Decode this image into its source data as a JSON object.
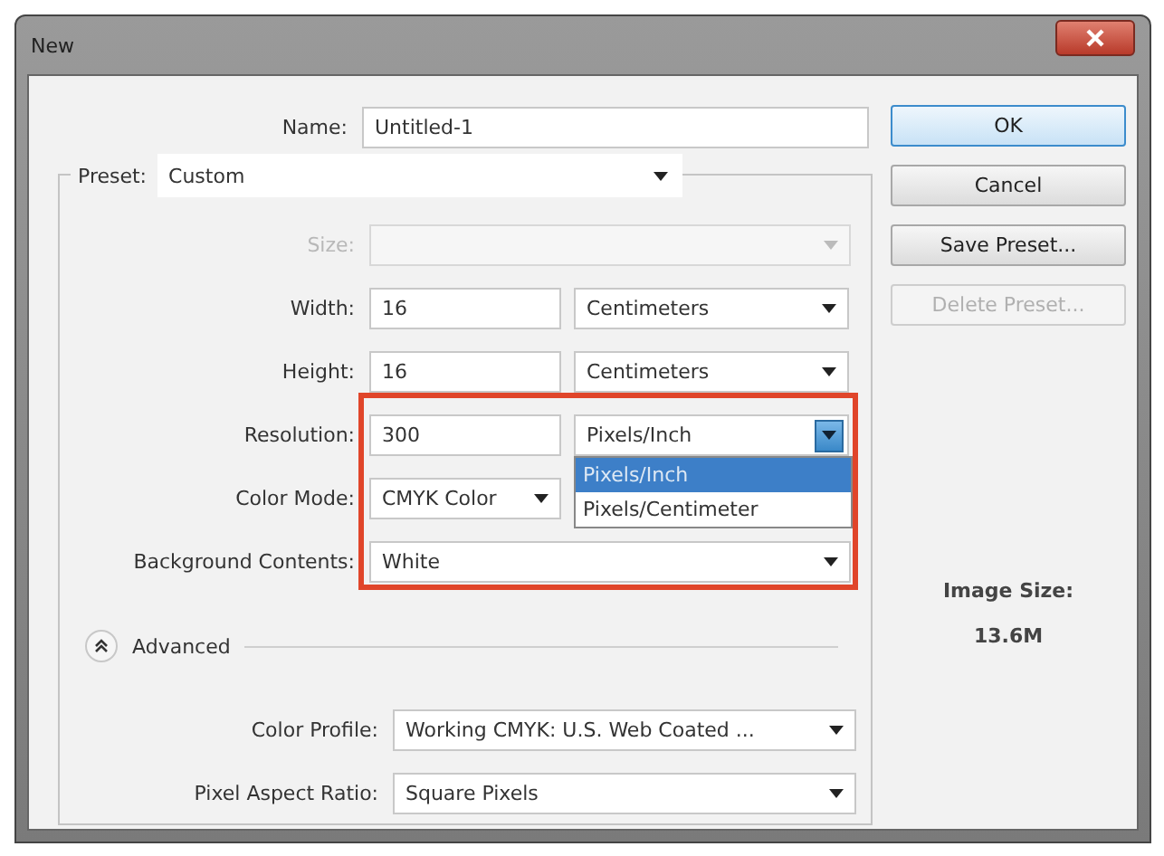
{
  "window": {
    "title": "New"
  },
  "name_field": {
    "label": "Name:",
    "value": "Untitled-1"
  },
  "preset": {
    "label": "Preset:",
    "value": "Custom"
  },
  "rows": [
    {
      "kind": "size",
      "label": "Size:",
      "disabled": true,
      "highlighted": false
    },
    {
      "kind": "number_unit",
      "label": "Width:",
      "value": "16",
      "unit": "Centimeters",
      "open": false,
      "highlighted": false
    },
    {
      "kind": "number_unit",
      "label": "Height:",
      "value": "16",
      "unit": "Centimeters",
      "open": false,
      "highlighted": false
    },
    {
      "kind": "number_unit",
      "label": "Resolution:",
      "value": "300",
      "unit": "Pixels/Inch",
      "open": true,
      "highlighted": true,
      "options": [
        {
          "label": "Pixels/Inch",
          "selected": true
        },
        {
          "label": "Pixels/Centimeter",
          "selected": false
        }
      ]
    },
    {
      "kind": "select_short",
      "label": "Color Mode:",
      "value": "CMYK Color",
      "highlighted": true
    },
    {
      "kind": "select_wide",
      "label": "Background Contents:",
      "value": "White",
      "highlighted": true
    }
  ],
  "advanced": {
    "label": "Advanced",
    "expanded": true
  },
  "advanced_rows": [
    {
      "label": "Color Profile:",
      "value": "Working CMYK:  U.S. Web Coated ..."
    },
    {
      "label": "Pixel Aspect Ratio:",
      "value": "Square Pixels"
    }
  ],
  "buttons": [
    {
      "label": "OK",
      "default": true,
      "disabled": false
    },
    {
      "label": "Cancel",
      "default": false,
      "disabled": false
    },
    {
      "label": "Save Preset...",
      "default": false,
      "disabled": false
    },
    {
      "label": "Delete Preset...",
      "default": false,
      "disabled": true
    }
  ],
  "image_size": {
    "label": "Image Size:",
    "value": "13.6M"
  }
}
